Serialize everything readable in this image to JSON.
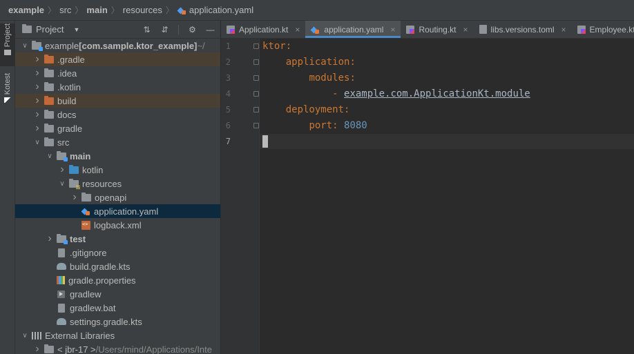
{
  "breadcrumb": {
    "items": [
      "example",
      "src",
      "main",
      "resources",
      "application.yaml"
    ]
  },
  "toolwindows": {
    "left": [
      {
        "label": "Project",
        "active": true
      },
      {
        "label": "Kotest",
        "active": false
      }
    ]
  },
  "project_panel": {
    "title": "Project",
    "tools": [
      "collapse-all-icon",
      "expand-all-icon",
      "gear-icon",
      "minimize-icon"
    ],
    "tree": [
      {
        "label": "example",
        "suffix": " [com.sample.ktor_example]",
        "extra": " ~/",
        "depth": 0,
        "expanded": true,
        "icon": "module-folder",
        "bold_suffix": true
      },
      {
        "label": ".gradle",
        "depth": 1,
        "expanded": false,
        "icon": "orange-folder",
        "excluded": true
      },
      {
        "label": ".idea",
        "depth": 1,
        "expanded": false,
        "icon": "folder"
      },
      {
        "label": ".kotlin",
        "depth": 1,
        "expanded": false,
        "icon": "folder"
      },
      {
        "label": "build",
        "depth": 1,
        "expanded": false,
        "icon": "orange-folder",
        "excluded": true
      },
      {
        "label": "docs",
        "depth": 1,
        "expanded": false,
        "icon": "folder"
      },
      {
        "label": "gradle",
        "depth": 1,
        "expanded": false,
        "icon": "folder"
      },
      {
        "label": "src",
        "depth": 1,
        "expanded": true,
        "icon": "folder"
      },
      {
        "label": "main",
        "depth": 2,
        "expanded": true,
        "icon": "module-folder",
        "bold": true
      },
      {
        "label": "kotlin",
        "depth": 3,
        "expanded": false,
        "icon": "blue-folder"
      },
      {
        "label": "resources",
        "depth": 3,
        "expanded": true,
        "icon": "resources-folder"
      },
      {
        "label": "openapi",
        "depth": 4,
        "expanded": false,
        "icon": "folder"
      },
      {
        "label": "application.yaml",
        "depth": 4,
        "leaf": true,
        "icon": "yaml-file",
        "selected": true
      },
      {
        "label": "logback.xml",
        "depth": 4,
        "leaf": true,
        "icon": "xml-file"
      },
      {
        "label": "test",
        "depth": 2,
        "expanded": false,
        "icon": "module-folder",
        "bold": true
      },
      {
        "label": ".gitignore",
        "depth": 2,
        "leaf": true,
        "icon": "gitignore-file"
      },
      {
        "label": "build.gradle.kts",
        "depth": 2,
        "leaf": true,
        "icon": "gradle-file"
      },
      {
        "label": "gradle.properties",
        "depth": 2,
        "leaf": true,
        "icon": "properties-file"
      },
      {
        "label": "gradlew",
        "depth": 2,
        "leaf": true,
        "icon": "exec-file"
      },
      {
        "label": "gradlew.bat",
        "depth": 2,
        "leaf": true,
        "icon": "bat-file"
      },
      {
        "label": "settings.gradle.kts",
        "depth": 2,
        "leaf": true,
        "icon": "gradle-file"
      },
      {
        "label": "External Libraries",
        "depth": 0,
        "expanded": true,
        "icon": "library"
      },
      {
        "label": "< jbr-17 >",
        "extra": " /Users/mind/Applications/Inte",
        "depth": 1,
        "expanded": false,
        "icon": "jdk"
      }
    ]
  },
  "editor": {
    "tabs": [
      {
        "label": "Application.kt",
        "icon": "kotlin-file",
        "active": false
      },
      {
        "label": "application.yaml",
        "icon": "yaml-file",
        "active": true
      },
      {
        "label": "Routing.kt",
        "icon": "kotlin-file",
        "active": false
      },
      {
        "label": "libs.versions.toml",
        "icon": "toml-file",
        "active": false
      },
      {
        "label": "Employee.kt",
        "icon": "kotlin-file",
        "active": false
      }
    ],
    "line_numbers": [
      "1",
      "2",
      "3",
      "4",
      "5",
      "6",
      "7"
    ],
    "current_line": 7,
    "code": [
      {
        "indent": "",
        "key": "ktor",
        "colon": ":"
      },
      {
        "indent": "    ",
        "key": "application",
        "colon": ":"
      },
      {
        "indent": "        ",
        "key": "modules",
        "colon": ":"
      },
      {
        "indent": "            ",
        "dash": "- ",
        "ref": "example.com.ApplicationKt.module"
      },
      {
        "indent": "    ",
        "key": "deployment",
        "colon": ":"
      },
      {
        "indent": "        ",
        "key": "port",
        "colon": ": ",
        "number": "8080"
      },
      {
        "indent": ""
      }
    ]
  },
  "colors": {
    "keyword": "#cc7832",
    "number": "#6897bb",
    "selection": "#0d293e",
    "excluded": "#4a3f33",
    "tab_underline": "#4a88c7"
  }
}
